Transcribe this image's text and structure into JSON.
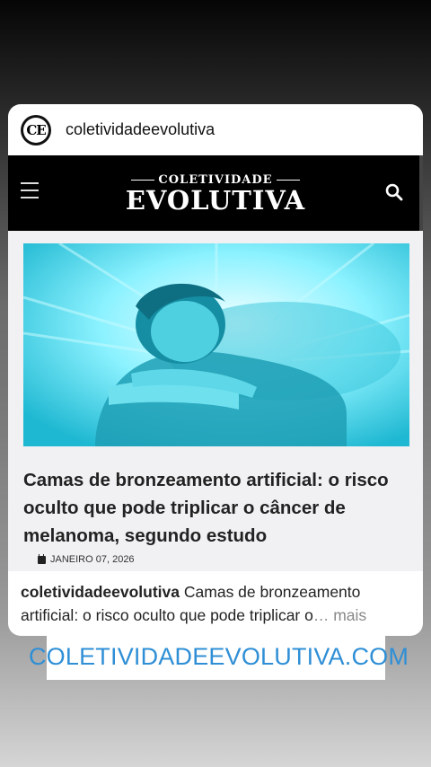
{
  "post": {
    "avatar_text": "CE",
    "username": "coletividadeevolutiva"
  },
  "site": {
    "logo_top": "COLETIVIDADE",
    "logo_bottom": "EVOLUTIVA"
  },
  "article": {
    "headline": "Camas de bronzeamento artificial: o risco oculto que pode triplicar o câncer de melanoma, segundo estudo",
    "date": "JANEIRO 07, 2026"
  },
  "caption": {
    "username": "coletividadeevolutiva",
    "text": "Camas de bronzeamento artificial: o risco oculto que pode triplicar o",
    "ellipsis": "…",
    "more": " mais"
  },
  "link_sticker": {
    "text": "COLETIVIDADEEVOLUTIVA.COM",
    "icon": "link-icon",
    "color": "#2f8fd6"
  }
}
